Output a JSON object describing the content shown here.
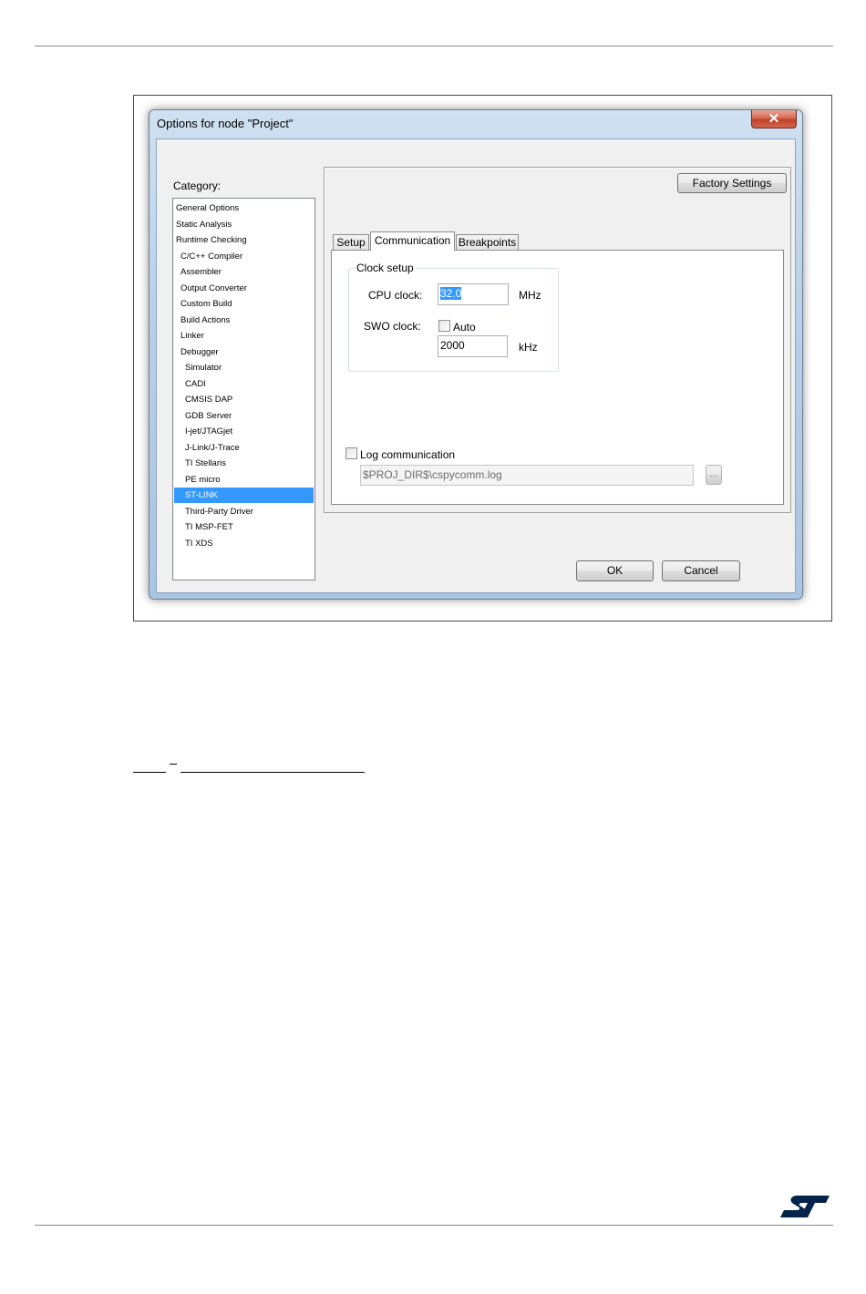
{
  "window": {
    "title": "Options for node \"Project\"",
    "close_glyph": "✕"
  },
  "category": {
    "label": "Category:",
    "items": [
      {
        "label": "General Options",
        "indent": 0
      },
      {
        "label": "Static Analysis",
        "indent": 0
      },
      {
        "label": "Runtime Checking",
        "indent": 0
      },
      {
        "label": "C/C++ Compiler",
        "indent": 1
      },
      {
        "label": "Assembler",
        "indent": 1
      },
      {
        "label": "Output Converter",
        "indent": 1
      },
      {
        "label": "Custom Build",
        "indent": 1
      },
      {
        "label": "Build Actions",
        "indent": 1
      },
      {
        "label": "Linker",
        "indent": 1
      },
      {
        "label": "Debugger",
        "indent": 1
      },
      {
        "label": "Simulator",
        "indent": 2
      },
      {
        "label": "CADI",
        "indent": 2
      },
      {
        "label": "CMSIS DAP",
        "indent": 2
      },
      {
        "label": "GDB Server",
        "indent": 2
      },
      {
        "label": "I-jet/JTAGjet",
        "indent": 2
      },
      {
        "label": "J-Link/J-Trace",
        "indent": 2
      },
      {
        "label": "TI Stellaris",
        "indent": 2
      },
      {
        "label": "PE micro",
        "indent": 2
      },
      {
        "label": "ST-LINK",
        "indent": 2,
        "selected": true
      },
      {
        "label": "Third-Party Driver",
        "indent": 2
      },
      {
        "label": "TI MSP-FET",
        "indent": 2
      },
      {
        "label": "TI XDS",
        "indent": 2
      }
    ]
  },
  "panel": {
    "factory_settings": "Factory Settings",
    "tabs": [
      "Setup",
      "Communication",
      "Breakpoints"
    ],
    "active_tab": "Communication",
    "clock_setup": {
      "title": "Clock setup",
      "cpu_clock_label": "CPU clock:",
      "cpu_clock_value": "32.0",
      "cpu_clock_unit": "MHz",
      "swo_clock_label": "SWO clock:",
      "auto_label": "Auto",
      "auto_checked": false,
      "swo_clock_value": "2000",
      "swo_clock_unit": "kHz"
    },
    "log": {
      "label": "Log communication",
      "checked": false,
      "path": "$PROJ_DIR$\\cspycomm.log",
      "browse": "..."
    }
  },
  "buttons": {
    "ok": "OK",
    "cancel": "Cancel"
  },
  "colors": {
    "selection": "#3399ff",
    "brand": "#03234b"
  },
  "logo": {
    "name": "st-logo-icon",
    "text": "ST"
  }
}
